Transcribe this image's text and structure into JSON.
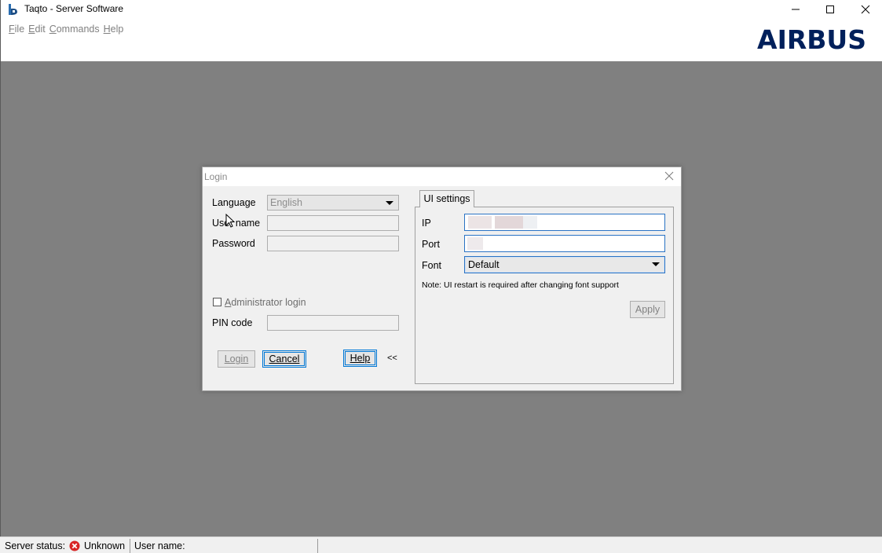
{
  "window": {
    "title": "Taqto - Server Software",
    "controls": [
      "minimize",
      "maximize",
      "close"
    ]
  },
  "menu": {
    "items": [
      {
        "accel": "F",
        "rest": "ile"
      },
      {
        "accel": "E",
        "rest": "dit"
      },
      {
        "accel": "C",
        "rest": "ommands"
      },
      {
        "accel": "H",
        "rest": "elp"
      }
    ]
  },
  "brand": {
    "logo_text": "AIRBUS",
    "color": "#00205b"
  },
  "login_dialog": {
    "title": "Login",
    "language_label": "Language",
    "language_value": "English",
    "username_label": "User name",
    "password_label": "Password",
    "admin_login_label": "Administrator login",
    "admin_login_checked": false,
    "pin_label": "PIN code",
    "login_button": "Login",
    "cancel_button": "Cancel",
    "help_button": "Help",
    "collapse_label": "<<",
    "ui_settings": {
      "tab_label": "UI settings",
      "ip_label": "IP",
      "ip_value": "",
      "port_label": "Port",
      "port_value": "",
      "font_label": "Font",
      "font_value": "Default",
      "note": "Note: UI restart is required after changing font support",
      "apply_button": "Apply"
    }
  },
  "status_bar": {
    "server_status_label": "Server status:",
    "server_status_value": "Unknown",
    "username_label": "User name:",
    "username_value": ""
  }
}
